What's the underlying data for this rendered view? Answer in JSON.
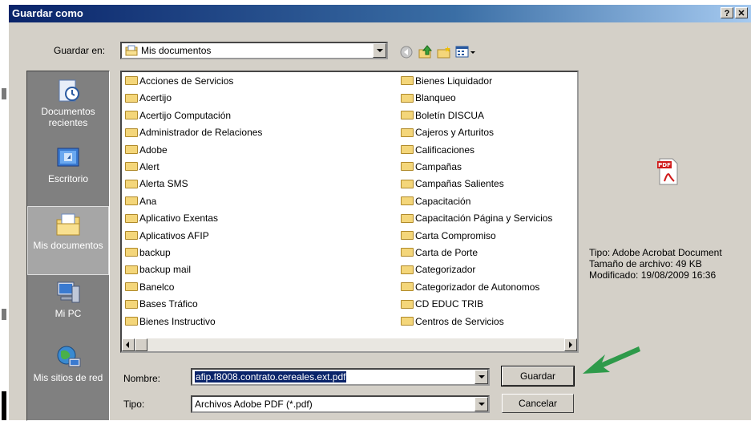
{
  "dialog": {
    "title": "Guardar como",
    "help_label": "?",
    "close_label": "✕"
  },
  "location": {
    "label": "Guardar en:",
    "value": "Mis documentos"
  },
  "toolbar": {
    "icons": [
      "back-icon",
      "up-folder-icon",
      "new-folder-icon",
      "view-menu-icon"
    ]
  },
  "places": [
    {
      "label": "Documentos recientes",
      "icon": "recent-documents-icon"
    },
    {
      "label": "Escritorio",
      "icon": "desktop-icon"
    },
    {
      "label": "Mis documentos",
      "icon": "my-documents-icon",
      "selected": true
    },
    {
      "label": "Mi PC",
      "icon": "my-computer-icon"
    },
    {
      "label": "Mis sitios de red",
      "icon": "network-places-icon"
    }
  ],
  "folders_col1": [
    "Acciones de Servicios",
    "Acertijo",
    "Acertijo Computación",
    "Administrador de Relaciones",
    "Adobe",
    "Alert",
    "Alerta SMS",
    "Ana",
    "Aplicativo Exentas",
    "Aplicativos AFIP",
    "backup",
    "backup mail",
    "Banelco",
    "Bases Tráfico",
    "Bienes Instructivo"
  ],
  "folders_col2": [
    "Bienes Liquidador",
    "Blanqueo",
    "Boletín DISCUA",
    "Cajeros y Arturitos",
    "Calificaciones",
    "Campañas",
    "Campañas Salientes",
    "Capacitación",
    "Capacitación Página y Servicios",
    "Carta Compromiso",
    "Carta de Porte",
    "Categorizador",
    "Categorizador de Autonomos",
    "CD EDUC TRIB",
    "Centros de Servicios"
  ],
  "preview": {
    "icon": "pdf-file-icon",
    "type_line": "Tipo: Adobe Acrobat Document",
    "size_line": "Tamaño de archivo: 49 KB",
    "modified_line": "Modificado: 19/08/2009 16:36"
  },
  "filename": {
    "label": "Nombre:",
    "value": "afip.f8008.contrato.cereales.ext.pdf"
  },
  "filetype": {
    "label": "Tipo:",
    "value": "Archivos Adobe PDF (*.pdf)"
  },
  "buttons": {
    "save": "Guardar",
    "cancel": "Cancelar"
  },
  "annotation": {
    "arrow_color": "#2e9a4a"
  }
}
